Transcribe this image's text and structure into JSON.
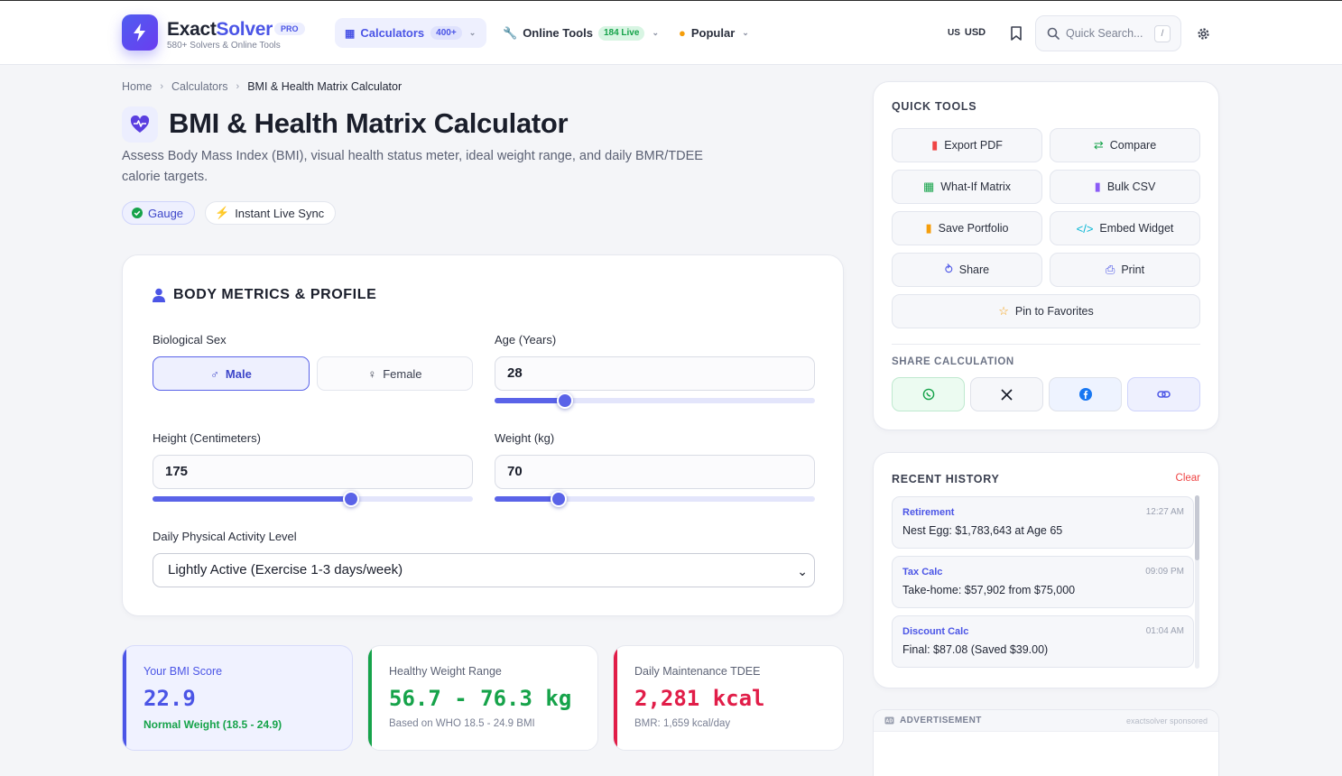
{
  "header": {
    "brand_part1": "Exact",
    "brand_part2": "Solver",
    "pro_badge": "PRO",
    "tagline": "580+ Solvers & Online Tools",
    "nav": {
      "calculators_label": "Calculators",
      "calculators_count": "400+",
      "tools_label": "Online Tools",
      "tools_live": "184 Live",
      "popular_label": "Popular"
    },
    "currency_flag": "US",
    "currency": "USD",
    "search_placeholder": "Quick Search...",
    "search_shortcut": "/"
  },
  "breadcrumb": [
    "Home",
    "Calculators",
    "BMI & Health Matrix Calculator"
  ],
  "page": {
    "title": "BMI & Health Matrix Calculator",
    "description": "Assess Body Mass Index (BMI), visual health status meter, ideal weight range, and daily BMR/TDEE calorie targets.",
    "badges": [
      "Gauge",
      "Instant Live Sync"
    ]
  },
  "form": {
    "section_title": "BODY METRICS & PROFILE",
    "sex_label": "Biological Sex",
    "sex_options": [
      "Male",
      "Female"
    ],
    "sex_selected": "Male",
    "age_label": "Age (Years)",
    "age_value": "28",
    "age_slider_fraction": 0.22,
    "height_label": "Height (Centimeters)",
    "height_value": "175",
    "height_slider_fraction": 0.62,
    "weight_label": "Weight (kg)",
    "weight_value": "70",
    "weight_slider_fraction": 0.2,
    "activity_label": "Daily Physical Activity Level",
    "activity_value": "Lightly Active (Exercise 1-3 days/week)"
  },
  "results": {
    "bmi": {
      "label": "Your BMI Score",
      "value": "22.9",
      "sub": "Normal Weight (18.5 - 24.9)",
      "color": "#4b55e6"
    },
    "healthy": {
      "label": "Healthy Weight Range",
      "value": "56.7 - 76.3 kg",
      "sub": "Based on WHO 18.5 - 24.9 BMI",
      "color": "#16a34a"
    },
    "tdee": {
      "label": "Daily Maintenance TDEE",
      "value": "2,281 kcal",
      "sub": "BMR: 1,659 kcal/day",
      "color": "#e11d48"
    }
  },
  "quick_tools": {
    "title": "QUICK TOOLS",
    "items": [
      {
        "label": "Export PDF",
        "icon": "pdf-icon"
      },
      {
        "label": "Compare",
        "icon": "compare-icon"
      },
      {
        "label": "What-If Matrix",
        "icon": "table-icon"
      },
      {
        "label": "Bulk CSV",
        "icon": "csv-icon"
      },
      {
        "label": "Save Portfolio",
        "icon": "bookmark-icon"
      },
      {
        "label": "Embed Widget",
        "icon": "code-icon"
      },
      {
        "label": "Share",
        "icon": "share-icon"
      },
      {
        "label": "Print",
        "icon": "print-icon"
      },
      {
        "label": "Pin to Favorites",
        "icon": "star-icon"
      }
    ],
    "share_title": "SHARE CALCULATION"
  },
  "history": {
    "title": "RECENT HISTORY",
    "clear_label": "Clear",
    "items": [
      {
        "tool": "Retirement",
        "time": "12:27 AM",
        "value": "Nest Egg: $1,783,643 at Age 65"
      },
      {
        "tool": "Tax Calc",
        "time": "09:09 PM",
        "value": "Take-home: $57,902 from $75,000"
      },
      {
        "tool": "Discount Calc",
        "time": "01:04 AM",
        "value": "Final: $87.08 (Saved $39.00)"
      }
    ]
  },
  "ad": {
    "label": "ADVERTISEMENT",
    "sponsor": "exactsolver sponsored"
  }
}
